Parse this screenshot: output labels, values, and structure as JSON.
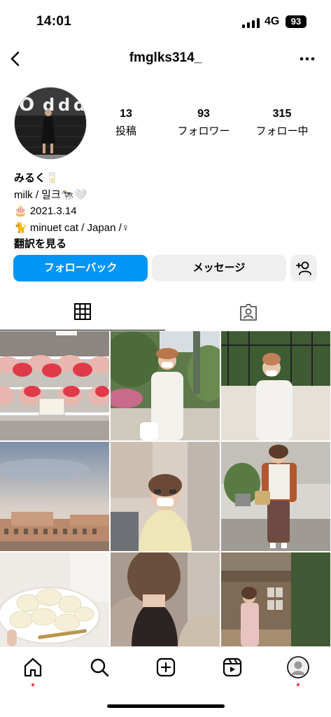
{
  "status_bar": {
    "time": "14:01",
    "network": "4G",
    "battery": "93"
  },
  "header": {
    "username": "fmglks314_"
  },
  "stats": [
    {
      "count": "13",
      "label": "投稿"
    },
    {
      "count": "93",
      "label": "フォロワー"
    },
    {
      "count": "315",
      "label": "フォロー中"
    }
  ],
  "bio": {
    "name": "みるく🥛",
    "line1": "milk / 밀크🐄🤍",
    "line2": "🎂 2021.3.14",
    "line3": "🐈 minuet cat / Japan /♀",
    "translate": "翻訳を見る"
  },
  "buttons": {
    "follow_back": "フォローバック",
    "message": "メッセージ"
  },
  "colors": {
    "accent": "#0095f6",
    "notification_dot": "#ff3040",
    "button_gray": "#efefef"
  },
  "icons": [
    "back-arrow-icon",
    "more-icon",
    "add-person-icon",
    "grid-icon",
    "tagged-icon",
    "home-icon",
    "search-icon",
    "create-icon",
    "reels-icon",
    "profile-avatar-icon"
  ]
}
